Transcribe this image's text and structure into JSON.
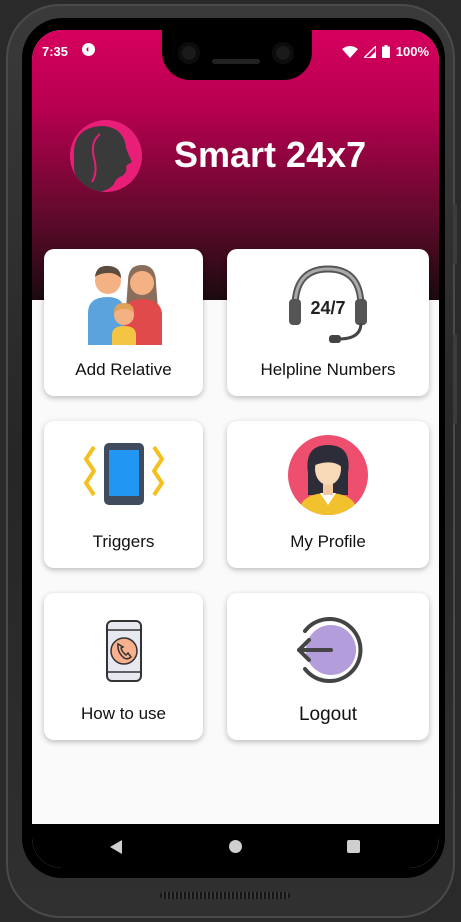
{
  "status_bar": {
    "time": "7:35",
    "battery": "100%",
    "icons": [
      "wifi-icon",
      "signal-icon",
      "battery-icon"
    ]
  },
  "header": {
    "title": "Smart 24x7",
    "logo_icon": "woman-silhouette-logo-icon",
    "gradient_top": "#d6005e",
    "gradient_bottom": "#1a0a0f"
  },
  "cards": [
    {
      "label": "Add Relative",
      "icon": "family-icon"
    },
    {
      "label": "Helpline Numbers",
      "icon": "headset-24-7-icon",
      "icon_text": "24/7"
    },
    {
      "label": "Triggers",
      "icon": "vibrating-phone-icon"
    },
    {
      "label": "My Profile",
      "icon": "woman-avatar-icon"
    },
    {
      "label": "How to use",
      "icon": "phone-call-icon"
    },
    {
      "label": "Logout",
      "icon": "logout-circle-arrow-icon"
    }
  ],
  "nav_bar": {
    "buttons": [
      "back-icon",
      "home-icon",
      "recents-icon"
    ]
  }
}
